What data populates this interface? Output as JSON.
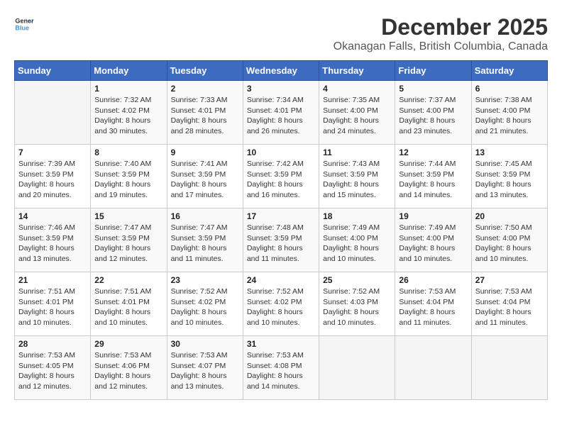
{
  "header": {
    "logo_line1": "General",
    "logo_line2": "Blue",
    "title": "December 2025",
    "subtitle": "Okanagan Falls, British Columbia, Canada"
  },
  "weekdays": [
    "Sunday",
    "Monday",
    "Tuesday",
    "Wednesday",
    "Thursday",
    "Friday",
    "Saturday"
  ],
  "weeks": [
    [
      {
        "day": "",
        "sunrise": "",
        "sunset": "",
        "daylight": ""
      },
      {
        "day": "1",
        "sunrise": "Sunrise: 7:32 AM",
        "sunset": "Sunset: 4:02 PM",
        "daylight": "Daylight: 8 hours and 30 minutes."
      },
      {
        "day": "2",
        "sunrise": "Sunrise: 7:33 AM",
        "sunset": "Sunset: 4:01 PM",
        "daylight": "Daylight: 8 hours and 28 minutes."
      },
      {
        "day": "3",
        "sunrise": "Sunrise: 7:34 AM",
        "sunset": "Sunset: 4:01 PM",
        "daylight": "Daylight: 8 hours and 26 minutes."
      },
      {
        "day": "4",
        "sunrise": "Sunrise: 7:35 AM",
        "sunset": "Sunset: 4:00 PM",
        "daylight": "Daylight: 8 hours and 24 minutes."
      },
      {
        "day": "5",
        "sunrise": "Sunrise: 7:37 AM",
        "sunset": "Sunset: 4:00 PM",
        "daylight": "Daylight: 8 hours and 23 minutes."
      },
      {
        "day": "6",
        "sunrise": "Sunrise: 7:38 AM",
        "sunset": "Sunset: 4:00 PM",
        "daylight": "Daylight: 8 hours and 21 minutes."
      }
    ],
    [
      {
        "day": "7",
        "sunrise": "Sunrise: 7:39 AM",
        "sunset": "Sunset: 3:59 PM",
        "daylight": "Daylight: 8 hours and 20 minutes."
      },
      {
        "day": "8",
        "sunrise": "Sunrise: 7:40 AM",
        "sunset": "Sunset: 3:59 PM",
        "daylight": "Daylight: 8 hours and 19 minutes."
      },
      {
        "day": "9",
        "sunrise": "Sunrise: 7:41 AM",
        "sunset": "Sunset: 3:59 PM",
        "daylight": "Daylight: 8 hours and 17 minutes."
      },
      {
        "day": "10",
        "sunrise": "Sunrise: 7:42 AM",
        "sunset": "Sunset: 3:59 PM",
        "daylight": "Daylight: 8 hours and 16 minutes."
      },
      {
        "day": "11",
        "sunrise": "Sunrise: 7:43 AM",
        "sunset": "Sunset: 3:59 PM",
        "daylight": "Daylight: 8 hours and 15 minutes."
      },
      {
        "day": "12",
        "sunrise": "Sunrise: 7:44 AM",
        "sunset": "Sunset: 3:59 PM",
        "daylight": "Daylight: 8 hours and 14 minutes."
      },
      {
        "day": "13",
        "sunrise": "Sunrise: 7:45 AM",
        "sunset": "Sunset: 3:59 PM",
        "daylight": "Daylight: 8 hours and 13 minutes."
      }
    ],
    [
      {
        "day": "14",
        "sunrise": "Sunrise: 7:46 AM",
        "sunset": "Sunset: 3:59 PM",
        "daylight": "Daylight: 8 hours and 13 minutes."
      },
      {
        "day": "15",
        "sunrise": "Sunrise: 7:47 AM",
        "sunset": "Sunset: 3:59 PM",
        "daylight": "Daylight: 8 hours and 12 minutes."
      },
      {
        "day": "16",
        "sunrise": "Sunrise: 7:47 AM",
        "sunset": "Sunset: 3:59 PM",
        "daylight": "Daylight: 8 hours and 11 minutes."
      },
      {
        "day": "17",
        "sunrise": "Sunrise: 7:48 AM",
        "sunset": "Sunset: 3:59 PM",
        "daylight": "Daylight: 8 hours and 11 minutes."
      },
      {
        "day": "18",
        "sunrise": "Sunrise: 7:49 AM",
        "sunset": "Sunset: 4:00 PM",
        "daylight": "Daylight: 8 hours and 10 minutes."
      },
      {
        "day": "19",
        "sunrise": "Sunrise: 7:49 AM",
        "sunset": "Sunset: 4:00 PM",
        "daylight": "Daylight: 8 hours and 10 minutes."
      },
      {
        "day": "20",
        "sunrise": "Sunrise: 7:50 AM",
        "sunset": "Sunset: 4:00 PM",
        "daylight": "Daylight: 8 hours and 10 minutes."
      }
    ],
    [
      {
        "day": "21",
        "sunrise": "Sunrise: 7:51 AM",
        "sunset": "Sunset: 4:01 PM",
        "daylight": "Daylight: 8 hours and 10 minutes."
      },
      {
        "day": "22",
        "sunrise": "Sunrise: 7:51 AM",
        "sunset": "Sunset: 4:01 PM",
        "daylight": "Daylight: 8 hours and 10 minutes."
      },
      {
        "day": "23",
        "sunrise": "Sunrise: 7:52 AM",
        "sunset": "Sunset: 4:02 PM",
        "daylight": "Daylight: 8 hours and 10 minutes."
      },
      {
        "day": "24",
        "sunrise": "Sunrise: 7:52 AM",
        "sunset": "Sunset: 4:02 PM",
        "daylight": "Daylight: 8 hours and 10 minutes."
      },
      {
        "day": "25",
        "sunrise": "Sunrise: 7:52 AM",
        "sunset": "Sunset: 4:03 PM",
        "daylight": "Daylight: 8 hours and 10 minutes."
      },
      {
        "day": "26",
        "sunrise": "Sunrise: 7:53 AM",
        "sunset": "Sunset: 4:04 PM",
        "daylight": "Daylight: 8 hours and 11 minutes."
      },
      {
        "day": "27",
        "sunrise": "Sunrise: 7:53 AM",
        "sunset": "Sunset: 4:04 PM",
        "daylight": "Daylight: 8 hours and 11 minutes."
      }
    ],
    [
      {
        "day": "28",
        "sunrise": "Sunrise: 7:53 AM",
        "sunset": "Sunset: 4:05 PM",
        "daylight": "Daylight: 8 hours and 12 minutes."
      },
      {
        "day": "29",
        "sunrise": "Sunrise: 7:53 AM",
        "sunset": "Sunset: 4:06 PM",
        "daylight": "Daylight: 8 hours and 12 minutes."
      },
      {
        "day": "30",
        "sunrise": "Sunrise: 7:53 AM",
        "sunset": "Sunset: 4:07 PM",
        "daylight": "Daylight: 8 hours and 13 minutes."
      },
      {
        "day": "31",
        "sunrise": "Sunrise: 7:53 AM",
        "sunset": "Sunset: 4:08 PM",
        "daylight": "Daylight: 8 hours and 14 minutes."
      },
      {
        "day": "",
        "sunrise": "",
        "sunset": "",
        "daylight": ""
      },
      {
        "day": "",
        "sunrise": "",
        "sunset": "",
        "daylight": ""
      },
      {
        "day": "",
        "sunrise": "",
        "sunset": "",
        "daylight": ""
      }
    ]
  ]
}
